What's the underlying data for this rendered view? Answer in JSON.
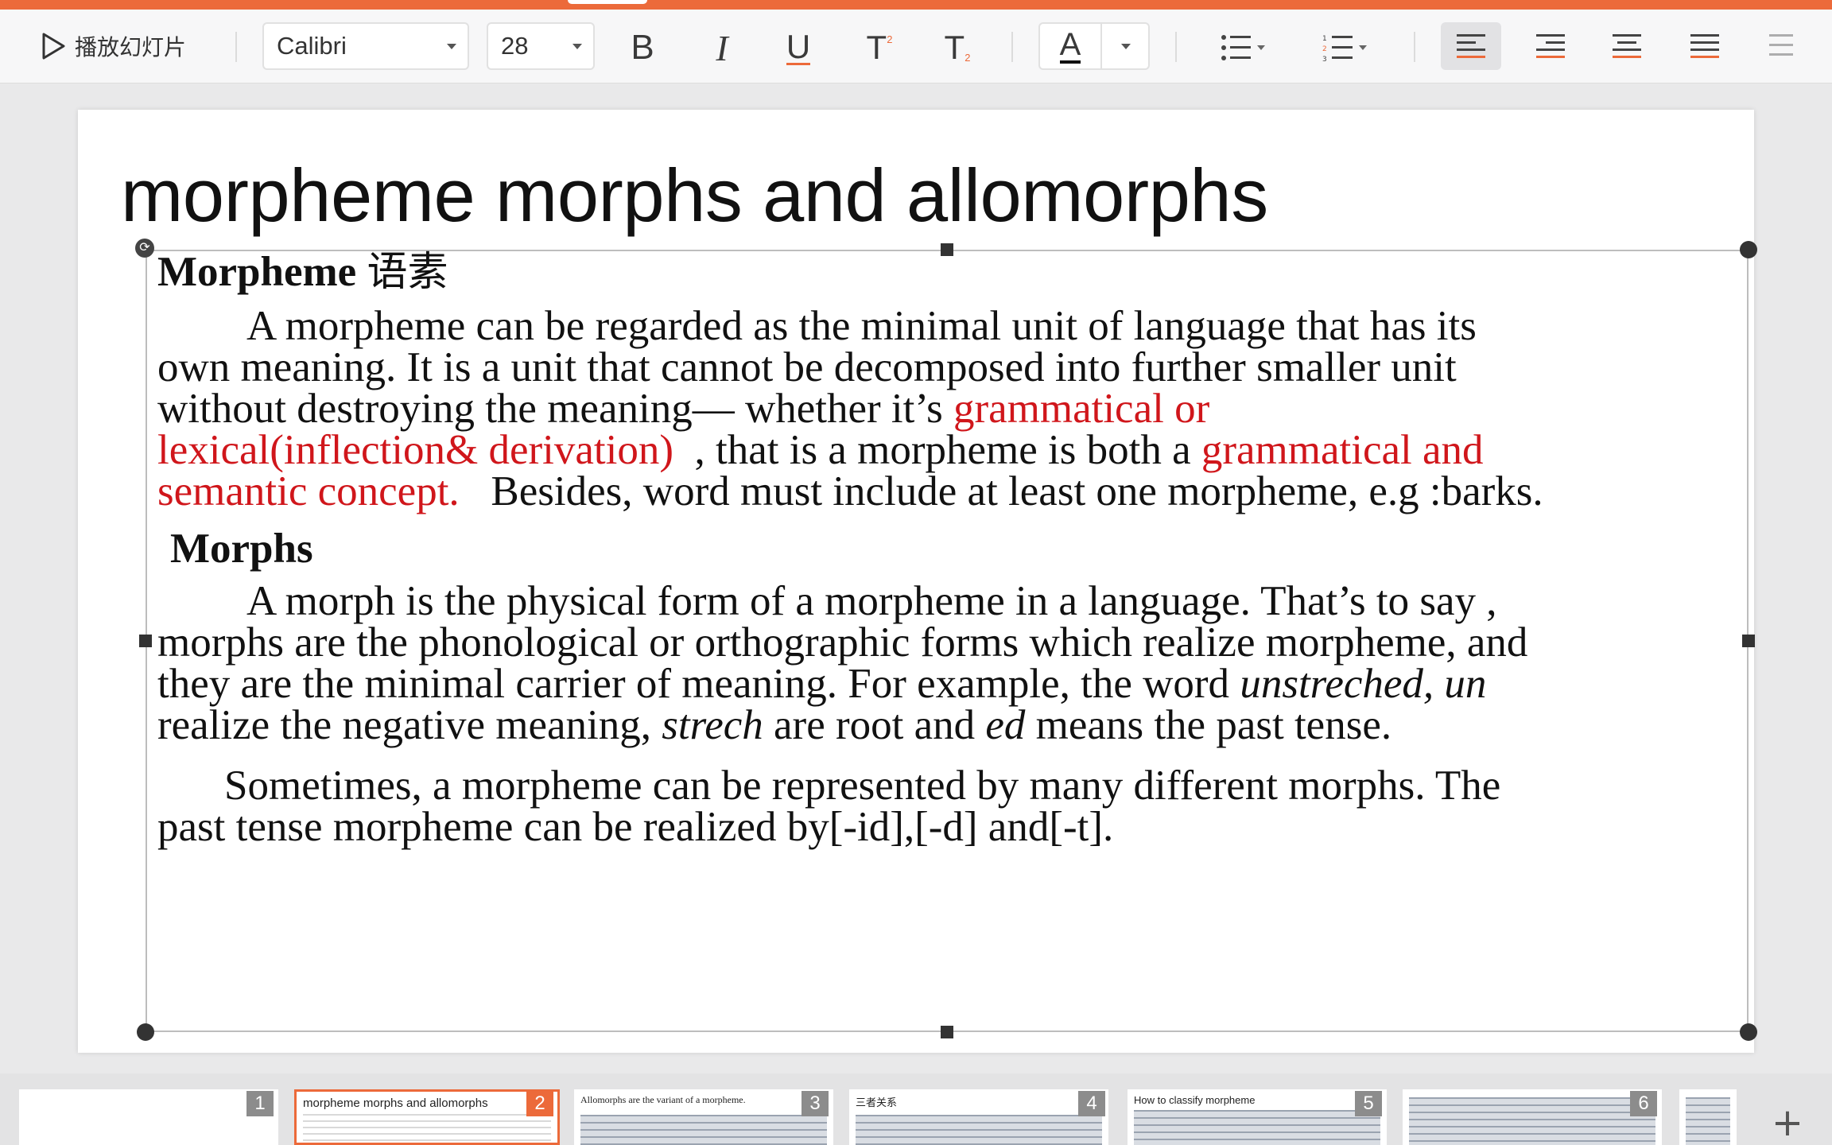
{
  "app": {
    "accent_color": "#ec6a3a"
  },
  "toolbar": {
    "play_label": "播放幻灯片",
    "font_name": "Calibri",
    "font_size": "28",
    "bold_label": "B",
    "italic_label": "I",
    "underline_label": "U",
    "superscript_label": "T",
    "subscript_label": "T",
    "font_color_label": "A"
  },
  "slide": {
    "title": "morpheme morphs and allomorphs",
    "morpheme_heading": "Morpheme",
    "morpheme_heading_cn": "语素",
    "p1_line1": "A morpheme can be regarded as the minimal unit of language that has its",
    "p1_line2": "own meaning. It is a unit that cannot be decomposed into further smaller unit",
    "p1_line3_a": "without destroying the meaning— whether it’s ",
    "p1_line3_red": "grammatical or",
    "p1_line4_red": "lexical(inflection& derivation)",
    "p1_line4_b": "  , that is a morpheme is both a ",
    "p1_line4_red2": "grammatical and",
    "p1_line5_red": "semantic concept.",
    "p1_line5_b": "   Besides, word must include at least one morpheme, e.g :barks.",
    "morphs_heading": "Morphs",
    "p2_line1": "A morph is the physical form of a morpheme in a language. That’s to say ,",
    "p2_line2": "morphs are the phonological or orthographic forms which realize morpheme, and",
    "p2_line3_a": "they are the minimal carrier of meaning. For example, the word ",
    "p2_line3_it": "unstreched, un",
    "p2_line4_a": "realize the negative meaning, ",
    "p2_line4_it1": "strech",
    "p2_line4_b": " are root and ",
    "p2_line4_it2": "ed",
    "p2_line4_c": " means the past tense.",
    "p3_line1": "Sometimes, a morpheme can be represented by many different morphs. The",
    "p3_line2": "past tense morpheme can be realized by[-id],[-d] and[-t]."
  },
  "thumbnails": [
    {
      "number": "1",
      "title": ""
    },
    {
      "number": "2",
      "title": "morpheme morphs and allomorphs"
    },
    {
      "number": "3",
      "title": "Allomorphs are the variant of a morpheme."
    },
    {
      "number": "4",
      "title": "三者关系"
    },
    {
      "number": "5",
      "title": "How to classify morpheme"
    },
    {
      "number": "6",
      "title": ""
    }
  ],
  "add_slide_label": "+"
}
